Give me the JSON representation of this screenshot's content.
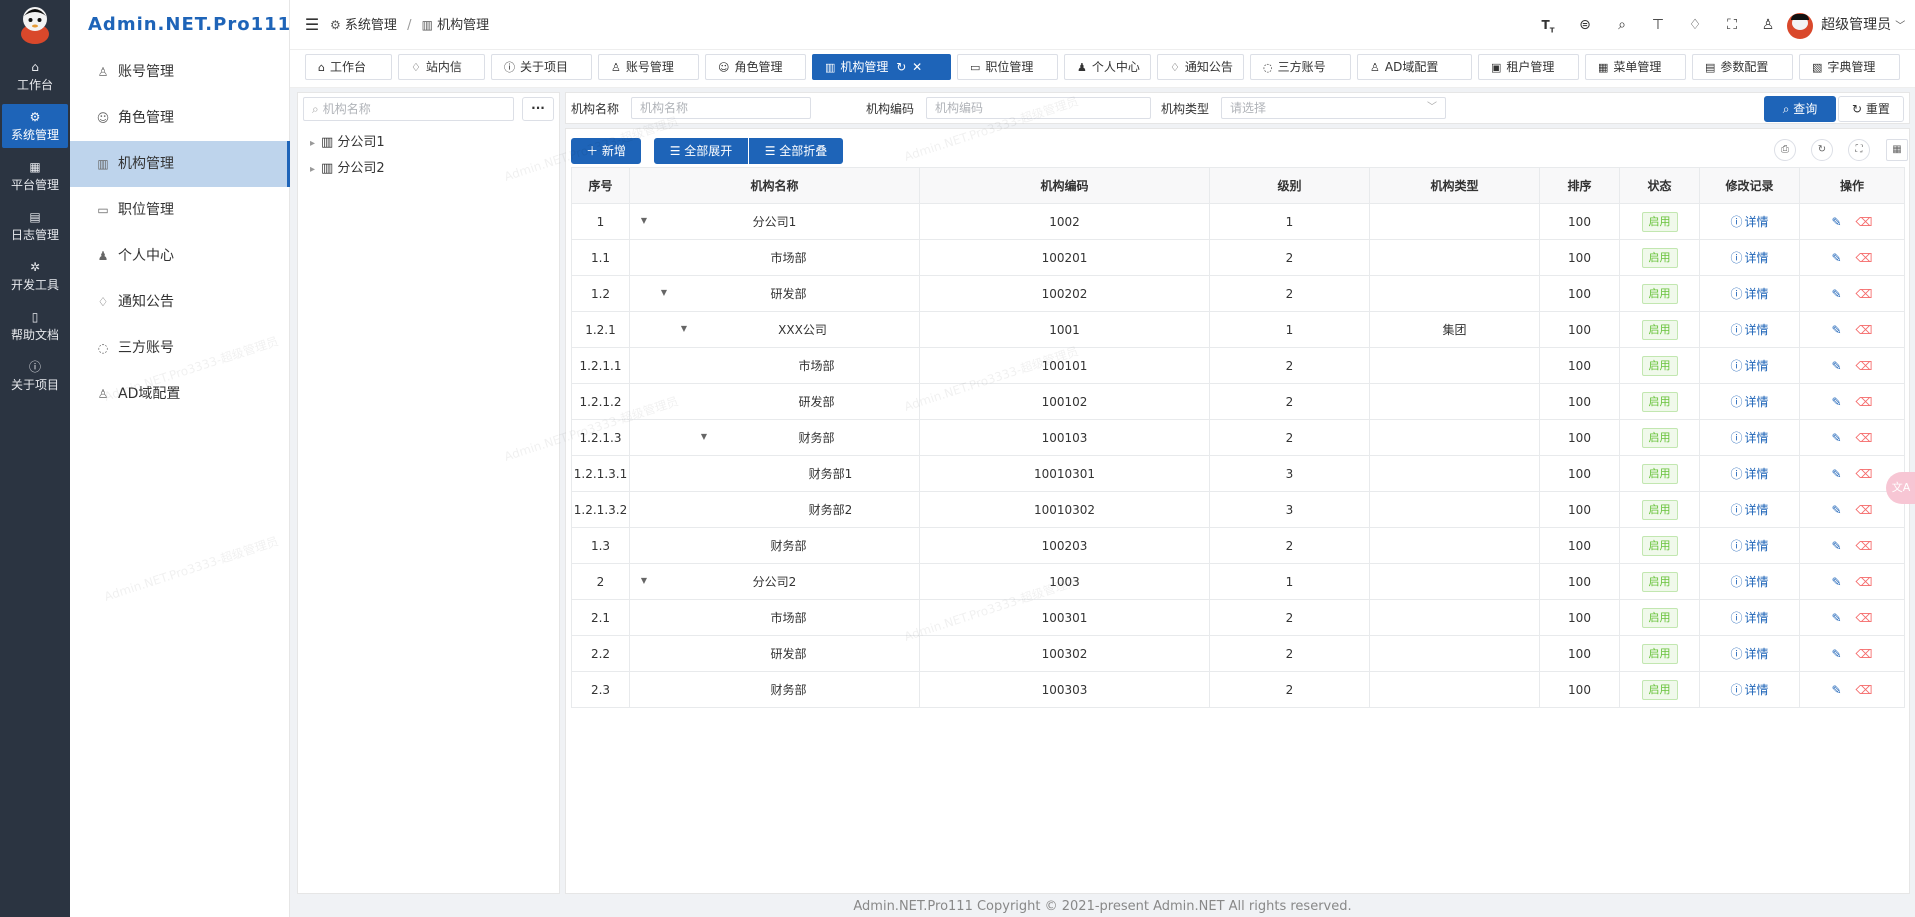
{
  "app": {
    "brand": "Admin.NET.Pro111"
  },
  "rail": [
    {
      "label": "工作台",
      "icon": "home-icon"
    },
    {
      "label": "系统管理",
      "icon": "gear-icon",
      "active": true
    },
    {
      "label": "平台管理",
      "icon": "grid-icon"
    },
    {
      "label": "日志管理",
      "icon": "document-icon"
    },
    {
      "label": "开发工具",
      "icon": "tool-icon"
    },
    {
      "label": "帮助文档",
      "icon": "book-icon"
    },
    {
      "label": "关于项目",
      "icon": "info-icon"
    }
  ],
  "menu": [
    {
      "label": "账号管理",
      "icon": "user-icon"
    },
    {
      "label": "角色管理",
      "icon": "role-icon"
    },
    {
      "label": "机构管理",
      "icon": "building-icon",
      "active": true
    },
    {
      "label": "职位管理",
      "icon": "position-icon"
    },
    {
      "label": "个人中心",
      "icon": "person-icon"
    },
    {
      "label": "通知公告",
      "icon": "bell-icon"
    },
    {
      "label": "三方账号",
      "icon": "chat-icon"
    },
    {
      "label": "AD域配置",
      "icon": "ad-user-icon"
    }
  ],
  "header": {
    "breadcrumb": [
      "系统管理",
      "机构管理"
    ],
    "separator": "/",
    "user": "超级管理员"
  },
  "tabs": [
    {
      "label": "工作台",
      "icon": "home-icon"
    },
    {
      "label": "站内信",
      "icon": "bell-icon"
    },
    {
      "label": "关于项目",
      "icon": "info-icon"
    },
    {
      "label": "账号管理",
      "icon": "user-icon"
    },
    {
      "label": "角色管理",
      "icon": "role-icon"
    },
    {
      "label": "机构管理",
      "icon": "building-icon",
      "active": true
    },
    {
      "label": "职位管理",
      "icon": "position-icon"
    },
    {
      "label": "个人中心",
      "icon": "person-icon"
    },
    {
      "label": "通知公告",
      "icon": "bell-icon"
    },
    {
      "label": "三方账号",
      "icon": "chat-icon"
    },
    {
      "label": "AD域配置",
      "icon": "ad-user-icon"
    },
    {
      "label": "租户管理",
      "icon": "tenant-icon"
    },
    {
      "label": "菜单管理",
      "icon": "menu-icon"
    },
    {
      "label": "参数配置",
      "icon": "config-icon"
    },
    {
      "label": "字典管理",
      "icon": "dict-icon"
    }
  ],
  "tree": {
    "search_placeholder": "机构名称",
    "more_label": "···",
    "nodes": [
      "分公司1",
      "分公司2"
    ]
  },
  "query": {
    "name_label": "机构名称",
    "name_placeholder": "机构名称",
    "code_label": "机构编码",
    "code_placeholder": "机构编码",
    "type_label": "机构类型",
    "type_placeholder": "请选择",
    "search_button": "查询",
    "reset_button": "重置"
  },
  "toolbar": {
    "add": "新增",
    "expand_all": "全部展开",
    "collapse_all": "全部折叠"
  },
  "table": {
    "columns": [
      "序号",
      "机构名称",
      "机构编码",
      "级别",
      "机构类型",
      "排序",
      "状态",
      "修改记录",
      "操作"
    ],
    "rows": [
      {
        "seq": "1",
        "name": "分公司1",
        "code": "1002",
        "level": "1",
        "type": "",
        "order": "100",
        "status": "启用",
        "record": "详情",
        "depth": 0,
        "caret": true
      },
      {
        "seq": "1.1",
        "name": "市场部",
        "code": "100201",
        "level": "2",
        "type": "",
        "order": "100",
        "status": "启用",
        "record": "详情",
        "depth": 1,
        "caret": false
      },
      {
        "seq": "1.2",
        "name": "研发部",
        "code": "100202",
        "level": "2",
        "type": "",
        "order": "100",
        "status": "启用",
        "record": "详情",
        "depth": 1,
        "caret": true
      },
      {
        "seq": "1.2.1",
        "name": "XXX公司",
        "code": "1001",
        "level": "1",
        "type": "集团",
        "order": "100",
        "status": "启用",
        "record": "详情",
        "depth": 2,
        "caret": true
      },
      {
        "seq": "1.2.1.1",
        "name": "市场部",
        "code": "100101",
        "level": "2",
        "type": "",
        "order": "100",
        "status": "启用",
        "record": "详情",
        "depth": 3,
        "caret": false
      },
      {
        "seq": "1.2.1.2",
        "name": "研发部",
        "code": "100102",
        "level": "2",
        "type": "",
        "order": "100",
        "status": "启用",
        "record": "详情",
        "depth": 3,
        "caret": false
      },
      {
        "seq": "1.2.1.3",
        "name": "财务部",
        "code": "100103",
        "level": "2",
        "type": "",
        "order": "100",
        "status": "启用",
        "record": "详情",
        "depth": 3,
        "caret": true
      },
      {
        "seq": "1.2.1.3.1",
        "name": "财务部1",
        "code": "10010301",
        "level": "3",
        "type": "",
        "order": "100",
        "status": "启用",
        "record": "详情",
        "depth": 4,
        "caret": false
      },
      {
        "seq": "1.2.1.3.2",
        "name": "财务部2",
        "code": "10010302",
        "level": "3",
        "type": "",
        "order": "100",
        "status": "启用",
        "record": "详情",
        "depth": 4,
        "caret": false
      },
      {
        "seq": "1.3",
        "name": "财务部",
        "code": "100203",
        "level": "2",
        "type": "",
        "order": "100",
        "status": "启用",
        "record": "详情",
        "depth": 1,
        "caret": false
      },
      {
        "seq": "2",
        "name": "分公司2",
        "code": "1003",
        "level": "1",
        "type": "",
        "order": "100",
        "status": "启用",
        "record": "详情",
        "depth": 0,
        "caret": true
      },
      {
        "seq": "2.1",
        "name": "市场部",
        "code": "100301",
        "level": "2",
        "type": "",
        "order": "100",
        "status": "启用",
        "record": "详情",
        "depth": 1,
        "caret": false
      },
      {
        "seq": "2.2",
        "name": "研发部",
        "code": "100302",
        "level": "2",
        "type": "",
        "order": "100",
        "status": "启用",
        "record": "详情",
        "depth": 1,
        "caret": false
      },
      {
        "seq": "2.3",
        "name": "财务部",
        "code": "100303",
        "level": "2",
        "type": "",
        "order": "100",
        "status": "启用",
        "record": "详情",
        "depth": 1,
        "caret": false
      }
    ]
  },
  "footer": "Admin.NET.Pro111 Copyright © 2021-present Admin.NET All rights reserved.",
  "watermark": "Admin.NET.Pro3333-超级管理员",
  "colors": {
    "primary": "#1e64b8",
    "rail_bg": "#2b3441",
    "menu_active": "#bed4ec",
    "status_green": "#67c23a",
    "delete_red": "#f56c6c"
  }
}
